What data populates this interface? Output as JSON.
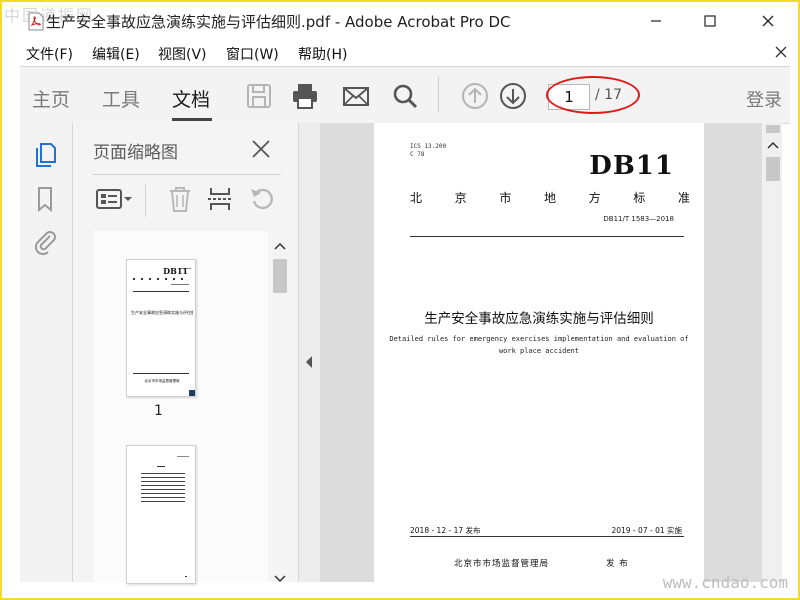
{
  "watermark": {
    "top_left": "中国道振网",
    "bottom_right": "www.cndao.com"
  },
  "window": {
    "title": "生产安全事故应急演练实施与评估细则.pdf - Adobe Acrobat Pro DC"
  },
  "menu": {
    "items": [
      "文件(F)",
      "编辑(E)",
      "视图(V)",
      "窗口(W)",
      "帮助(H)"
    ]
  },
  "toolbar": {
    "tabs": [
      "主页",
      "工具",
      "文档"
    ],
    "active_tab": "文档",
    "page_current": "1",
    "page_total": "/ 17",
    "login": "登录"
  },
  "thumbnails": {
    "panel_title": "页面缩略图",
    "pages": [
      {
        "label": "1",
        "db": "DB11",
        "title": "生产安全事故应急演练实施与评估细则",
        "issuer": "北京市市场监督管理局"
      },
      {
        "label": ""
      }
    ]
  },
  "document": {
    "ics": "ICS   13.200",
    "ccs": "C 78",
    "db": "DB11",
    "standard_chars": [
      "北",
      "京",
      "市",
      "地",
      "方",
      "标",
      "准"
    ],
    "standard_no": "DB11/T 1583—2018",
    "title_cn": "生产安全事故应急演练实施与评估细则",
    "title_en_1": "Detailed rules for emergency exercises implementation and evaluation of",
    "title_en_2": "work place accident",
    "issue_date": "2018 - 12 - 17 发布",
    "effective_date": "2019 - 07 - 01 实施",
    "issuer": "北京市市场监督管理局",
    "issue_word": "发 布"
  },
  "colors": {
    "annotation": "#e01818",
    "frame": "#f2dc2a",
    "icon_blue": "#1e73d4"
  }
}
